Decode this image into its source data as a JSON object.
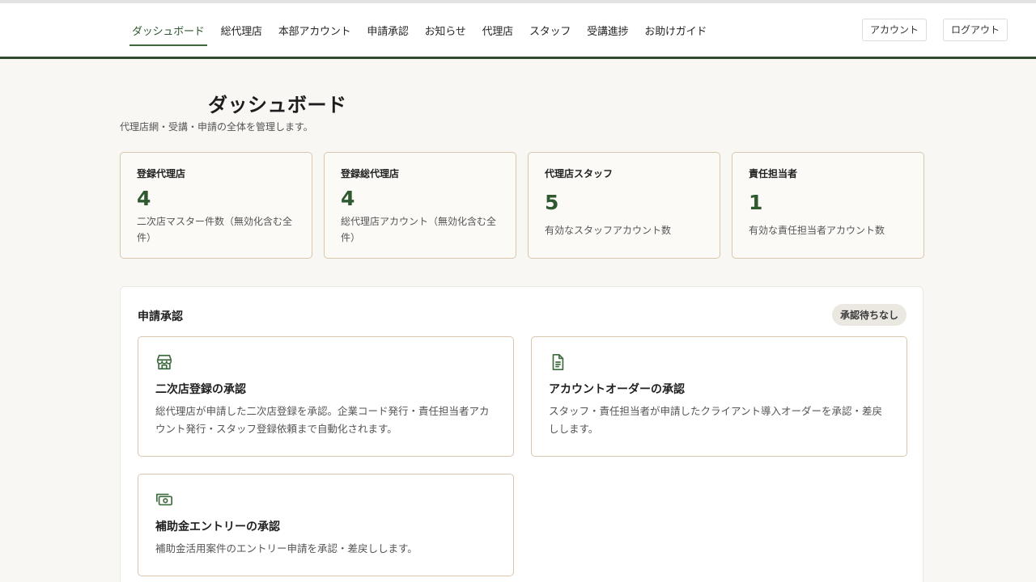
{
  "nav": {
    "items": [
      {
        "label": "ダッシュボード"
      },
      {
        "label": "総代理店"
      },
      {
        "label": "本部アカウント"
      },
      {
        "label": "申請承認"
      },
      {
        "label": "お知らせ"
      },
      {
        "label": "代理店"
      },
      {
        "label": "スタッフ"
      },
      {
        "label": "受講進捗"
      },
      {
        "label": "お助けガイド"
      }
    ],
    "active_index": 0,
    "account_label": "アカウント",
    "logout_label": "ログアウト"
  },
  "page": {
    "title": "ダッシュボード",
    "subtitle": "代理店網・受講・申請の全体を管理します。"
  },
  "stats": [
    {
      "label": "登録代理店",
      "value": "4",
      "desc": "二次店マスター件数（無効化含む全件）"
    },
    {
      "label": "登録総代理店",
      "value": "4",
      "desc": "総代理店アカウント（無効化含む全件）"
    },
    {
      "label": "代理店スタッフ",
      "value": "5",
      "desc": "有効なスタッフアカウント数"
    },
    {
      "label": "責任担当者",
      "value": "1",
      "desc": "有効な責任担当者アカウント数"
    }
  ],
  "approvals": {
    "title": "申請承認",
    "badge": "承認待ちなし",
    "cards": [
      {
        "icon": "store-icon",
        "title": "二次店登録の承認",
        "desc": "総代理店が申請した二次店登録を承認。企業コード発行・責任担当者アカウント発行・スタッフ登録依頼まで自動化されます。"
      },
      {
        "icon": "document-icon",
        "title": "アカウントオーダーの承認",
        "desc": "スタッフ・責任担当者が申請したクライアント導入オーダーを承認・差戻しします。"
      },
      {
        "icon": "money-icon",
        "title": "補助金エントリーの承認",
        "desc": "補助金活用案件のエントリー申請を承認・差戻しします。"
      }
    ]
  },
  "colors": {
    "accent": "#2f5a2f",
    "card_border": "#d8c6ae",
    "background": "#f8f7f3"
  }
}
